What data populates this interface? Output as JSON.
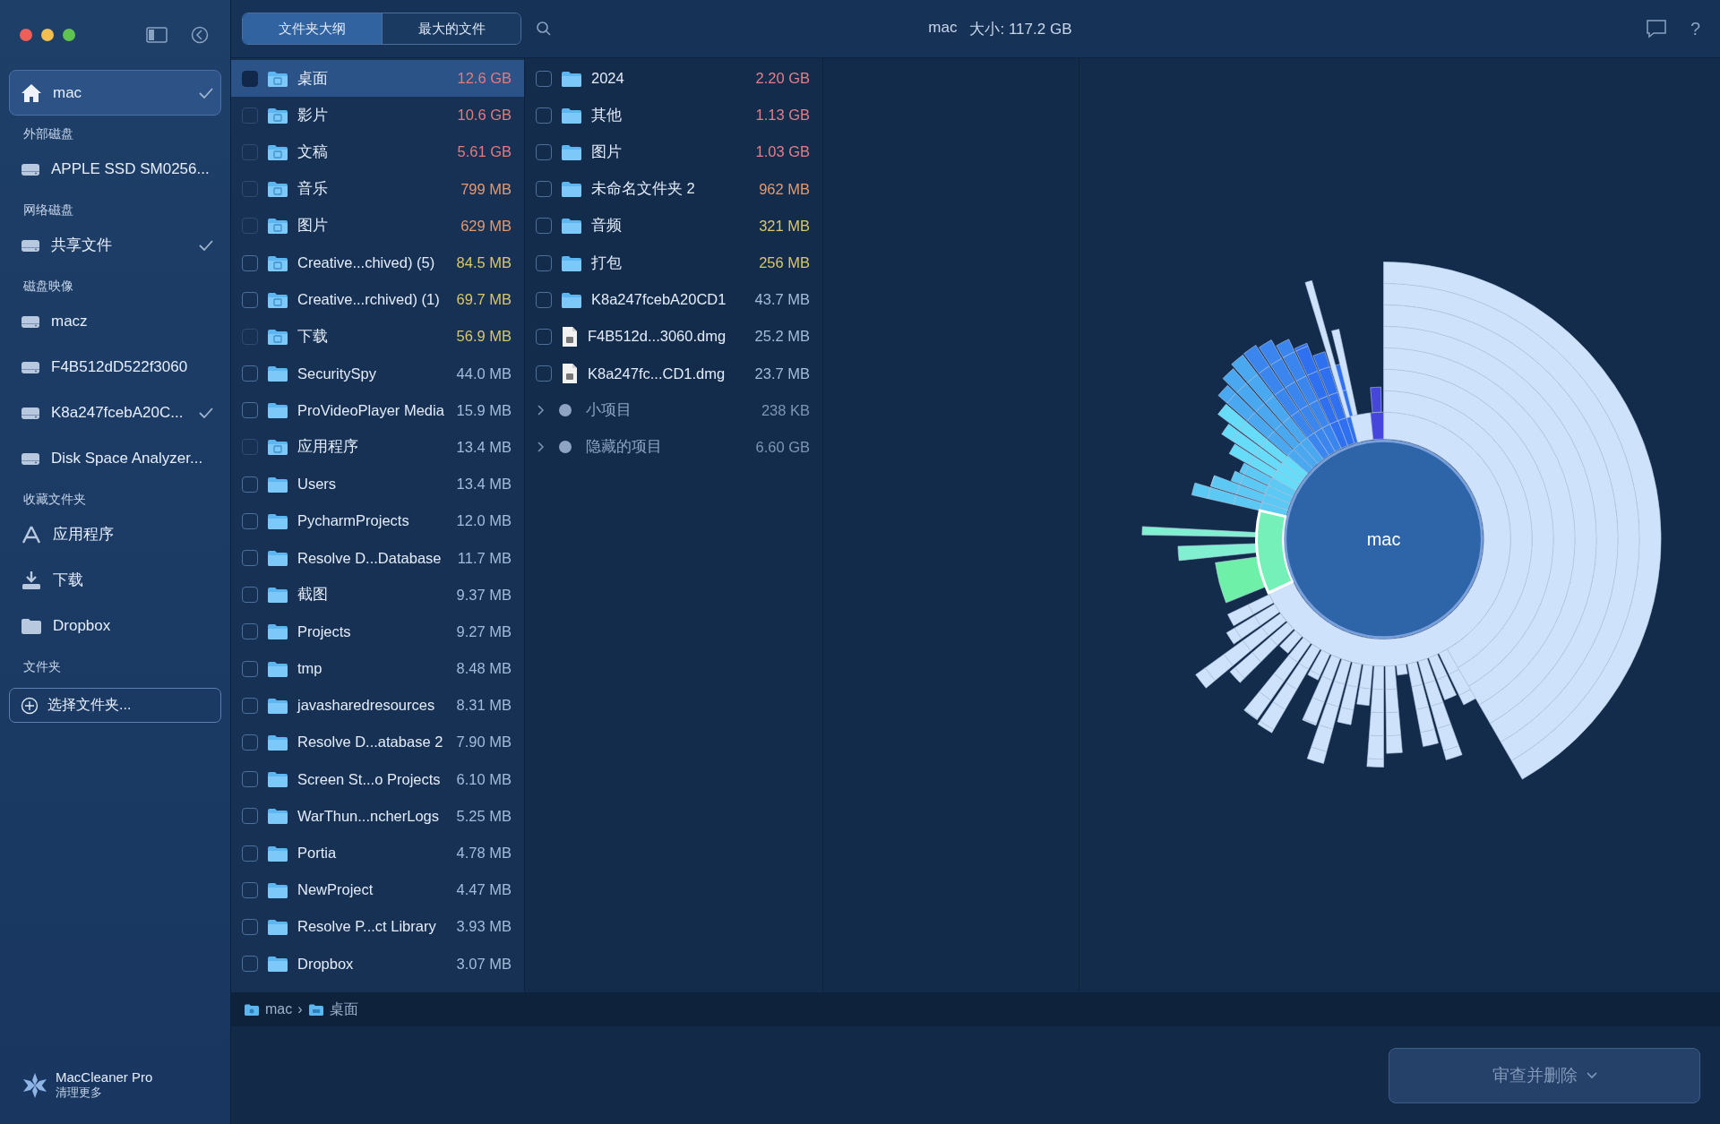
{
  "sidebar": {
    "sections": [
      {
        "items": [
          {
            "kind": "home",
            "label": "mac",
            "selected": true,
            "checked": true
          }
        ]
      },
      {
        "header": "外部磁盘",
        "items": [
          {
            "kind": "drive",
            "label": "APPLE SSD SM0256...",
            "selected": false,
            "checked": false
          }
        ]
      },
      {
        "header": "网络磁盘",
        "items": [
          {
            "kind": "drive",
            "label": "共享文件",
            "selected": false,
            "checked": true
          }
        ]
      },
      {
        "header": "磁盘映像",
        "items": [
          {
            "kind": "drive",
            "label": "macz",
            "selected": false,
            "checked": false
          },
          {
            "kind": "drive",
            "label": "F4B512dD522f3060",
            "selected": false,
            "checked": false
          },
          {
            "kind": "drive",
            "label": "K8a247fcebA20C...",
            "selected": false,
            "checked": true
          },
          {
            "kind": "drive",
            "label": "Disk Space Analyzer...",
            "selected": false,
            "checked": false
          }
        ]
      },
      {
        "header": "收藏文件夹",
        "items": [
          {
            "kind": "apps",
            "label": "应用程序",
            "selected": false,
            "checked": false
          },
          {
            "kind": "download",
            "label": "下载",
            "selected": false,
            "checked": false
          },
          {
            "kind": "folder",
            "label": "Dropbox",
            "selected": false,
            "checked": false
          }
        ]
      },
      {
        "header": "文件夹"
      }
    ],
    "add_button": "选择文件夹...",
    "footer": {
      "title": "MacCleaner Pro",
      "subtitle": "清理更多"
    }
  },
  "toolbar": {
    "tabs": [
      {
        "label": "文件夹大纲",
        "selected": true
      },
      {
        "label": "最大的文件",
        "selected": false
      }
    ],
    "title": "mac",
    "size": "大小: 117.2 GB",
    "help": "?"
  },
  "column_1": [
    {
      "kind": "system_folder",
      "name": "桌面",
      "size": "12.6 GB",
      "color": "#e8797c",
      "checked": false,
      "selected": true
    },
    {
      "kind": "system_folder",
      "name": "影片",
      "size": "10.6 GB",
      "color": "#e8797c",
      "checked": false,
      "disabled": true,
      "selected": false
    },
    {
      "kind": "system_folder",
      "name": "文稿",
      "size": "5.61 GB",
      "color": "#e8797c",
      "checked": false,
      "disabled": true,
      "selected": false
    },
    {
      "kind": "system_folder",
      "name": "音乐",
      "size": "799 MB",
      "color": "#e49a6e",
      "checked": false,
      "disabled": true,
      "selected": false
    },
    {
      "kind": "system_folder",
      "name": "图片",
      "size": "629 MB",
      "color": "#e49a6e",
      "checked": false,
      "disabled": true,
      "selected": false
    },
    {
      "kind": "system_folder",
      "name": "Creative...chived) (5)",
      "size": "84.5 MB",
      "color": "#d9c76a",
      "checked": false,
      "disabled": false,
      "selected": false
    },
    {
      "kind": "system_folder",
      "name": "Creative...rchived) (1)",
      "size": "69.7 MB",
      "color": "#d9c76a",
      "checked": false,
      "disabled": false,
      "selected": false
    },
    {
      "kind": "system_folder",
      "name": "下载",
      "size": "56.9 MB",
      "color": "#d9c76a",
      "checked": false,
      "disabled": true,
      "selected": false
    },
    {
      "kind": "folder",
      "name": "SecuritySpy",
      "size": "44.0 MB",
      "color": "#a3bcdc",
      "checked": false,
      "disabled": false,
      "selected": false
    },
    {
      "kind": "folder",
      "name": "ProVideoPlayer Media",
      "size": "15.9 MB",
      "color": "#a3bcdc",
      "checked": false,
      "disabled": false,
      "selected": false
    },
    {
      "kind": "system_folder",
      "name": "应用程序",
      "size": "13.4 MB",
      "color": "#a3bcdc",
      "checked": false,
      "disabled": true,
      "selected": false
    },
    {
      "kind": "folder",
      "name": "Users",
      "size": "13.4 MB",
      "color": "#a3bcdc",
      "checked": false,
      "disabled": false,
      "selected": false
    },
    {
      "kind": "folder",
      "name": "PycharmProjects",
      "size": "12.0 MB",
      "color": "#a3bcdc",
      "checked": false,
      "disabled": false,
      "selected": false
    },
    {
      "kind": "folder",
      "name": "Resolve D...Database",
      "size": "11.7 MB",
      "color": "#a3bcdc",
      "checked": false,
      "disabled": false,
      "selected": false
    },
    {
      "kind": "folder",
      "name": "截图",
      "size": "9.37 MB",
      "color": "#a3bcdc",
      "checked": false,
      "disabled": false,
      "selected": false
    },
    {
      "kind": "folder",
      "name": "Projects",
      "size": "9.27 MB",
      "color": "#a3bcdc",
      "checked": false,
      "disabled": false,
      "selected": false
    },
    {
      "kind": "folder",
      "name": "tmp",
      "size": "8.48 MB",
      "color": "#a3bcdc",
      "checked": false,
      "disabled": false,
      "selected": false
    },
    {
      "kind": "folder",
      "name": "javasharedresources",
      "size": "8.31 MB",
      "color": "#a3bcdc",
      "checked": false,
      "disabled": false,
      "selected": false
    },
    {
      "kind": "folder",
      "name": "Resolve D...atabase 2",
      "size": "7.90 MB",
      "color": "#a3bcdc",
      "checked": false,
      "disabled": false,
      "selected": false
    },
    {
      "kind": "folder",
      "name": "Screen St...o Projects",
      "size": "6.10 MB",
      "color": "#a3bcdc",
      "checked": false,
      "disabled": false,
      "selected": false
    },
    {
      "kind": "folder",
      "name": "WarThun...ncherLogs",
      "size": "5.25 MB",
      "color": "#a3bcdc",
      "checked": false,
      "disabled": false,
      "selected": false
    },
    {
      "kind": "folder",
      "name": "Portia",
      "size": "4.78 MB",
      "color": "#a3bcdc",
      "checked": false,
      "disabled": false,
      "selected": false
    },
    {
      "kind": "folder",
      "name": "NewProject",
      "size": "4.47 MB",
      "color": "#a3bcdc",
      "checked": false,
      "disabled": false,
      "selected": false
    },
    {
      "kind": "folder",
      "name": "Resolve P...ct Library",
      "size": "3.93 MB",
      "color": "#a3bcdc",
      "checked": false,
      "disabled": false,
      "selected": false
    },
    {
      "kind": "folder",
      "name": "Dropbox",
      "size": "3.07 MB",
      "color": "#a3bcdc",
      "checked": false,
      "disabled": false,
      "selected": false
    }
  ],
  "column_2": [
    {
      "kind": "folder",
      "name": "2024",
      "size": "2.20 GB",
      "color": "#e08088",
      "checked": false
    },
    {
      "kind": "folder",
      "name": "其他",
      "size": "1.13 GB",
      "color": "#e08088",
      "checked": false
    },
    {
      "kind": "folder",
      "name": "图片",
      "size": "1.03 GB",
      "color": "#e08088",
      "checked": false
    },
    {
      "kind": "folder",
      "name": "未命名文件夹 2",
      "size": "962 MB",
      "color": "#e49a6e",
      "checked": false
    },
    {
      "kind": "folder",
      "name": "音频",
      "size": "321 MB",
      "color": "#d9c76a",
      "checked": false
    },
    {
      "kind": "folder",
      "name": "打包",
      "size": "256 MB",
      "color": "#d9c76a",
      "checked": false
    },
    {
      "kind": "folder",
      "name": "K8a247fcebA20CD1",
      "size": "43.7 MB",
      "color": "#a3bcdc",
      "checked": false
    },
    {
      "kind": "file",
      "name": "F4B512d...3060.dmg",
      "size": "25.2 MB",
      "color": "#a3bcdc",
      "checked": false
    },
    {
      "kind": "file",
      "name": "K8a247fc...CD1.dmg",
      "size": "23.7 MB",
      "color": "#a3bcdc",
      "checked": false
    },
    {
      "kind": "group",
      "name": "小项目",
      "size": "238 KB",
      "expanded": false
    },
    {
      "kind": "group",
      "name": "隐藏的项目",
      "size": "6.60 GB",
      "expanded": false
    }
  ],
  "chart": {
    "center_label": "mac"
  },
  "breadcrumb": [
    {
      "kind": "disk",
      "label": "mac"
    },
    {
      "kind": "separator",
      "label": "›"
    },
    {
      "kind": "folder",
      "label": "桌面"
    }
  ],
  "action_button": "审查并删除"
}
